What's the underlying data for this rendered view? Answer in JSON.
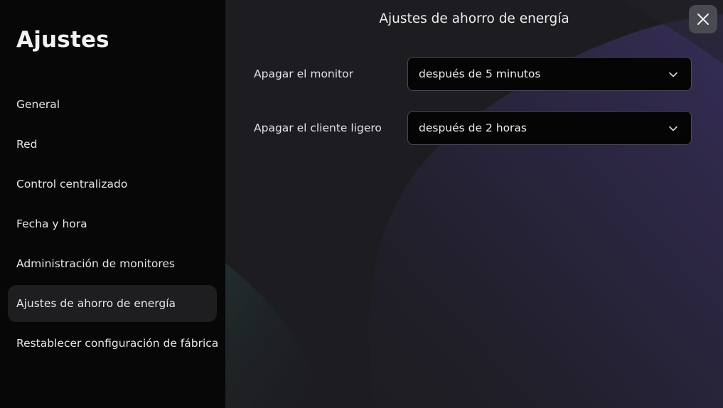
{
  "sidebar": {
    "title": "Ajustes",
    "items": [
      {
        "label": "General",
        "active": false
      },
      {
        "label": "Red",
        "active": false
      },
      {
        "label": "Control centralizado",
        "active": false
      },
      {
        "label": "Fecha y hora",
        "active": false
      },
      {
        "label": "Administración de monitores",
        "active": false
      },
      {
        "label": "Ajustes de ahorro de energía",
        "active": true
      },
      {
        "label": "Restablecer configuración de fábrica",
        "active": false
      }
    ]
  },
  "main": {
    "title": "Ajustes de ahorro de energía",
    "close_icon": "close-icon",
    "settings": [
      {
        "label": "Apagar el monitor",
        "value": "después de 5 minutos"
      },
      {
        "label": "Apagar el cliente ligero",
        "value": "después de 2 horas"
      }
    ]
  },
  "colors": {
    "sidebar_bg": "#070707",
    "main_bg": "#1c1c20",
    "active_item_bg": "#1e1e21",
    "select_border": "#4b4a58",
    "accent_purple": "#2e2748"
  }
}
